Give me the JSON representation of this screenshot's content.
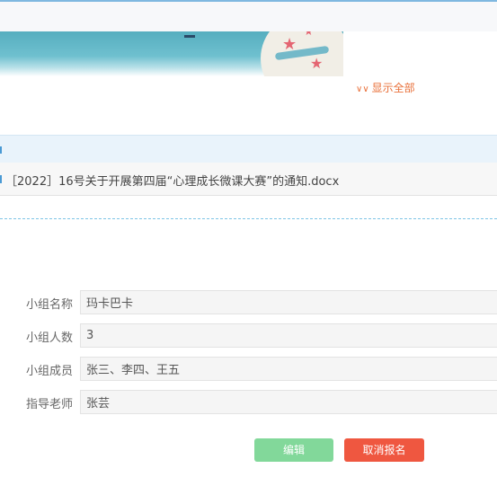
{
  "banner": {
    "show_all_label": "显示全部"
  },
  "attachments": {
    "files": [
      {
        "name": "［2022］16号关于开展第四届“心理成长微课大赛”的通知.docx"
      }
    ]
  },
  "form": {
    "fields": [
      {
        "label": "小组名称",
        "value": "玛卡巴卡"
      },
      {
        "label": "小组人数",
        "value": "3"
      },
      {
        "label": "小组成员",
        "value": "张三、李四、王五"
      },
      {
        "label": "指导老师",
        "value": "张芸"
      }
    ],
    "edit_label": "编辑",
    "cancel_label": "取消报名"
  },
  "colors": {
    "edit_button": "#82d89a",
    "cancel_button": "#ef5740",
    "show_all_link": "#e9703a",
    "attachment_header": "#e9f3fb"
  },
  "icons": {
    "show_all": "double-chevron-down-icon"
  }
}
